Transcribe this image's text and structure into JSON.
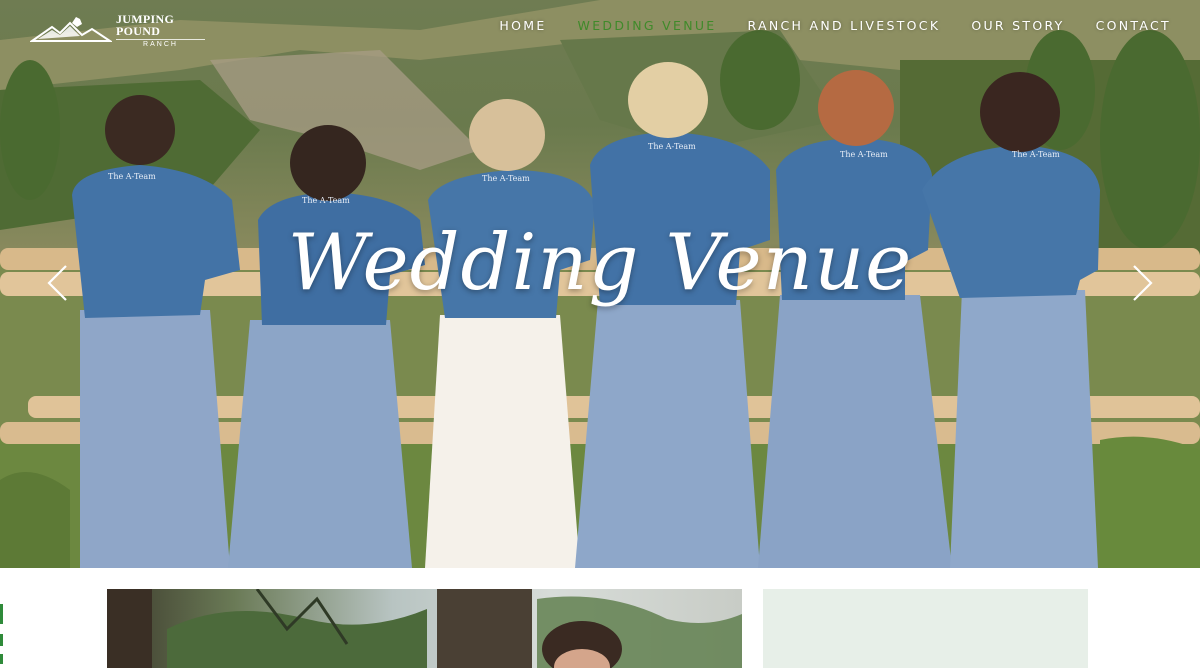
{
  "brand": {
    "name": "JUMPING POUND",
    "sub": "RANCH"
  },
  "nav": {
    "items": [
      {
        "label": "HOME",
        "active": false
      },
      {
        "label": "WEDDING VENUE",
        "active": true
      },
      {
        "label": "RANCH AND LIVESTOCK",
        "active": false
      },
      {
        "label": "OUR STORY",
        "active": false
      },
      {
        "label": "CONTACT",
        "active": false
      }
    ]
  },
  "hero": {
    "title": "Wedding Venue",
    "jacket_text": "The A-Team",
    "prev_icon": "chevron-left-icon",
    "next_icon": "chevron-right-icon"
  },
  "colors": {
    "nav_active": "#3f8a2a",
    "panel_bg": "#e7efe8",
    "denim": "#3f6f9f",
    "dress": "#8ea7c9"
  }
}
